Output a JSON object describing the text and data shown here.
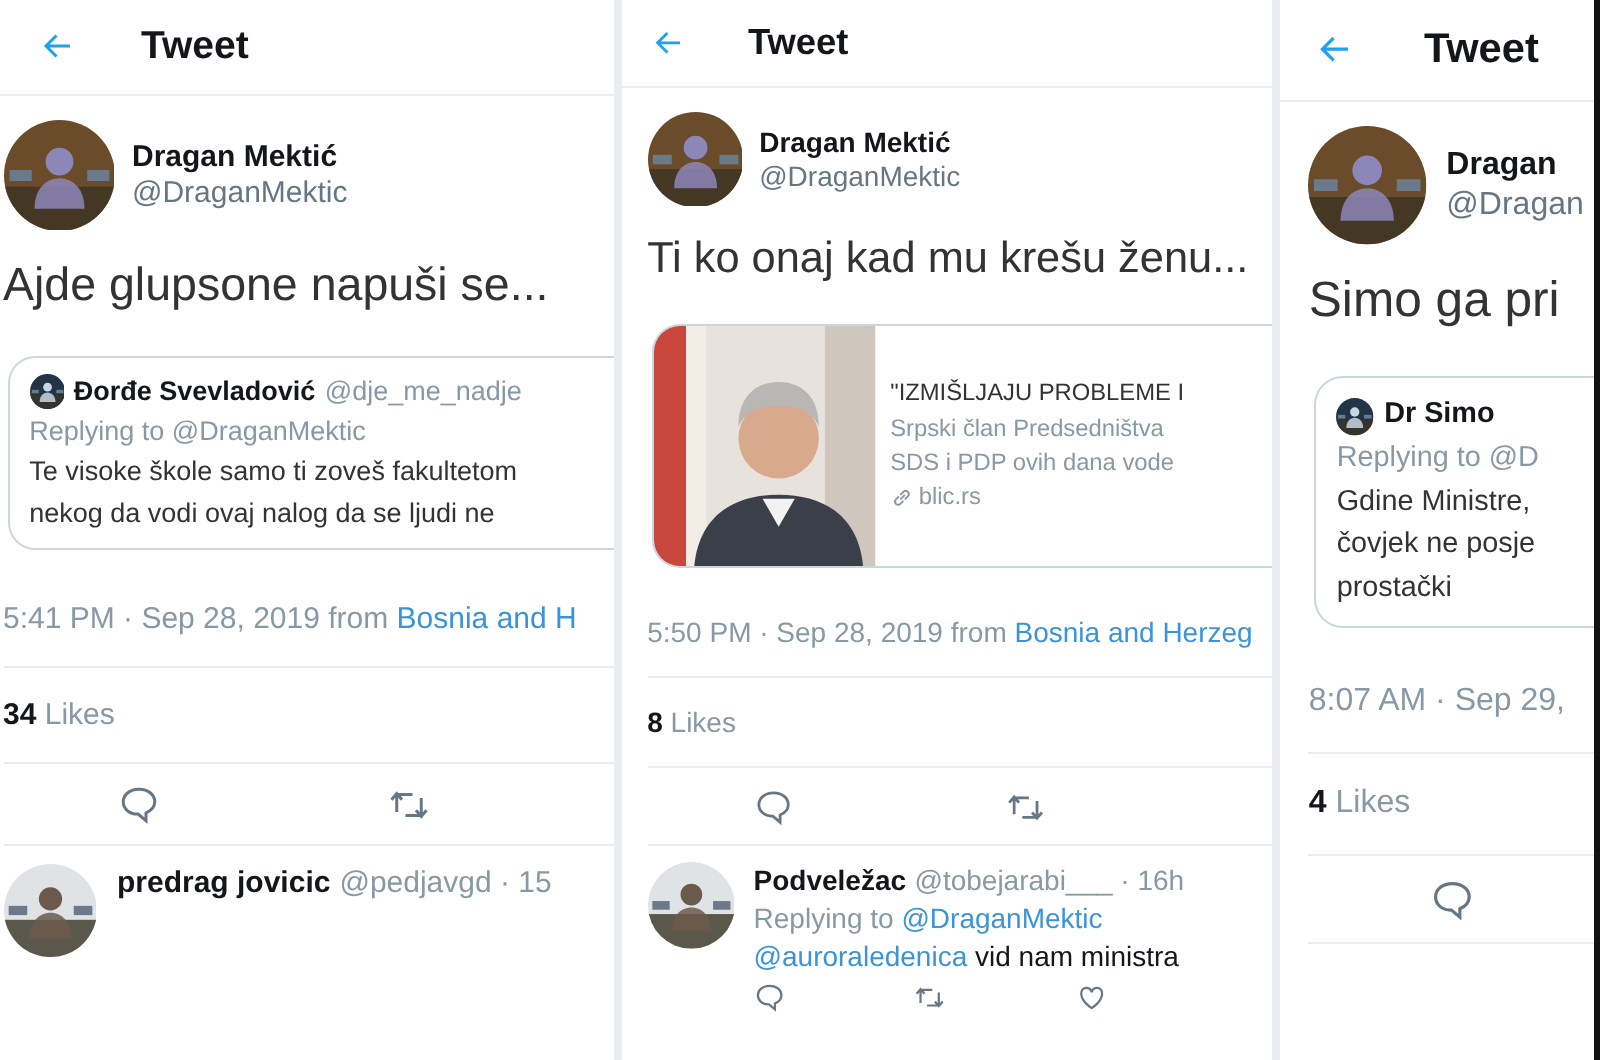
{
  "panels": [
    {
      "header": {
        "title": "Tweet"
      },
      "author": {
        "name": "Dragan Mektić",
        "handle": "@DraganMektic"
      },
      "text": "Ajde glupsone napuši se...",
      "embed": {
        "kind": "quote",
        "name": "Đorđe Svevladović",
        "handle": "@dje_me_nadje",
        "replying": "Replying to @DraganMektic",
        "lines": [
          "Te visoke škole samo ti zoveš fakultetom",
          "nekog da vodi ovaj nalog da se ljudi ne"
        ]
      },
      "timestamp": {
        "time": "5:41 PM · Sep 28, 2019 from",
        "source": "Bosnia and H"
      },
      "likes": {
        "count": "34",
        "label": "Likes"
      },
      "actions": [
        {
          "kind": "comment"
        },
        {
          "kind": "retweet"
        }
      ],
      "replies": [
        {
          "name": "predrag jovicic",
          "handle": "@pedjavgd · 15"
        }
      ]
    },
    {
      "header": {
        "title": "Tweet"
      },
      "author": {
        "name": "Dragan Mektić",
        "handle": "@DraganMektic"
      },
      "text": "Ti ko onaj kad mu krešu ženu...",
      "embed": {
        "kind": "link",
        "title": "\"IZMIŠLJAJU PROBLEME I",
        "lines": [
          "Srpski član Predsedništva",
          "SDS i PDP ovih dana vode"
        ],
        "domain": "blic.rs"
      },
      "timestamp": {
        "time": "5:50 PM · Sep 28, 2019 from",
        "source": "Bosnia and Herzeg"
      },
      "likes": {
        "count": "8",
        "label": "Likes"
      },
      "actions": [
        {
          "kind": "comment"
        },
        {
          "kind": "retweet"
        }
      ],
      "replies": [
        {
          "name": "Podveležac",
          "handle": "@tobejarabi___ · 16h",
          "replying": "Replying to",
          "replying_to": "@DraganMektic",
          "mention": "@auroraledenica",
          "text": "vid nam ministra",
          "actions": [
            {
              "kind": "comment"
            },
            {
              "kind": "retweet"
            },
            {
              "kind": "like"
            }
          ]
        }
      ]
    },
    {
      "header": {
        "title": "Tweet"
      },
      "author": {
        "name": "Dragan",
        "handle": "@Dragan"
      },
      "text": "Simo ga pri",
      "embed": {
        "kind": "quote",
        "name": "Dr Simo",
        "replying": "Replying to @D",
        "lines": [
          "Gdine Ministre,",
          "čovjek ne posje",
          "prostački"
        ]
      },
      "timestamp": {
        "time": "8:07 AM · Sep 29,"
      },
      "likes": {
        "count": "4",
        "label": "Likes"
      },
      "actions": [
        {
          "kind": "comment"
        }
      ]
    }
  ]
}
